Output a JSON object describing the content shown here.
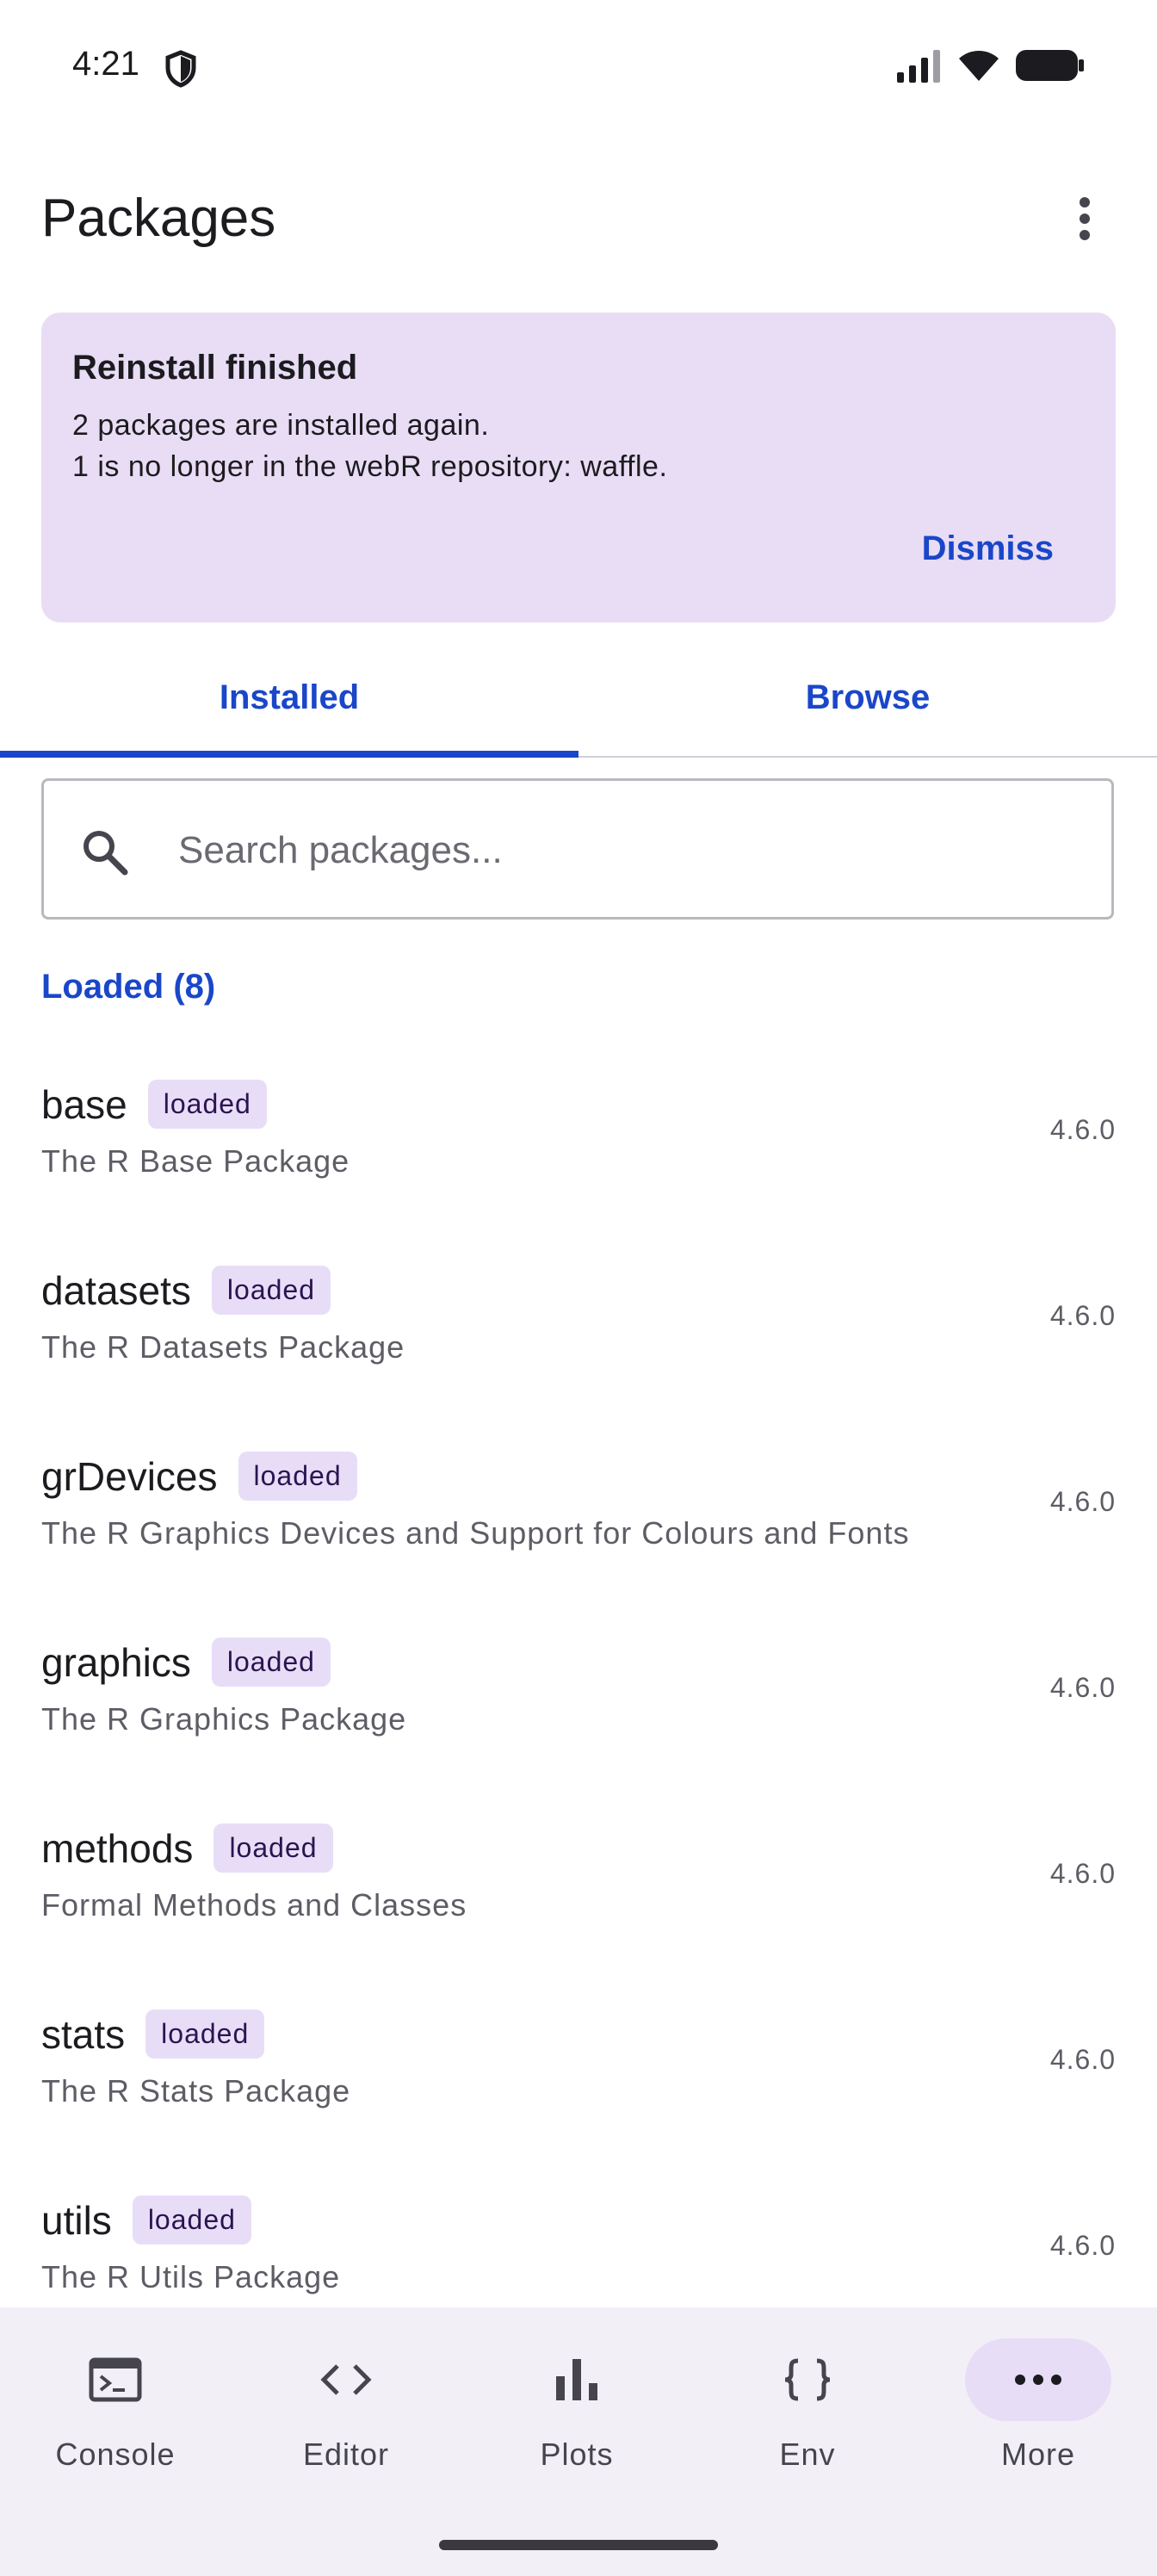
{
  "status_bar": {
    "time": "4:21"
  },
  "app_bar": {
    "title": "Packages"
  },
  "banner": {
    "title": "Reinstall finished",
    "line1": "2 packages are installed again.",
    "line2": "1 is no longer in the webR repository: waffle.",
    "dismiss_label": "Dismiss"
  },
  "tabs": [
    {
      "label": "Installed",
      "selected": true
    },
    {
      "label": "Browse",
      "selected": false
    }
  ],
  "search": {
    "placeholder": "Search packages...",
    "value": ""
  },
  "section": {
    "header": "Loaded (8)"
  },
  "packages": [
    {
      "name": "base",
      "badge": "loaded",
      "description": "The R Base Package",
      "version": "4.6.0"
    },
    {
      "name": "datasets",
      "badge": "loaded",
      "description": "The R Datasets Package",
      "version": "4.6.0"
    },
    {
      "name": "grDevices",
      "badge": "loaded",
      "description": "The R Graphics Devices and Support for Colours and Fonts",
      "version": "4.6.0"
    },
    {
      "name": "graphics",
      "badge": "loaded",
      "description": "The R Graphics Package",
      "version": "4.6.0"
    },
    {
      "name": "methods",
      "badge": "loaded",
      "description": "Formal Methods and Classes",
      "version": "4.6.0"
    },
    {
      "name": "stats",
      "badge": "loaded",
      "description": "The R Stats Package",
      "version": "4.6.0"
    },
    {
      "name": "utils",
      "badge": "loaded",
      "description": "The R Utils Package",
      "version": "4.6.0"
    }
  ],
  "bottom_nav": [
    {
      "label": "Console",
      "icon": "console-icon",
      "active": false
    },
    {
      "label": "Editor",
      "icon": "code-icon",
      "active": false
    },
    {
      "label": "Plots",
      "icon": "bar-chart-icon",
      "active": false
    },
    {
      "label": "Env",
      "icon": "braces-icon",
      "active": false
    },
    {
      "label": "More",
      "icon": "more-horiz-icon",
      "active": true
    }
  ],
  "colors": {
    "accent": "#1a47c9",
    "banner_bg": "#e8ddf5",
    "badge_bg": "#e8ddf7",
    "nav_bg": "#f2eff7"
  }
}
